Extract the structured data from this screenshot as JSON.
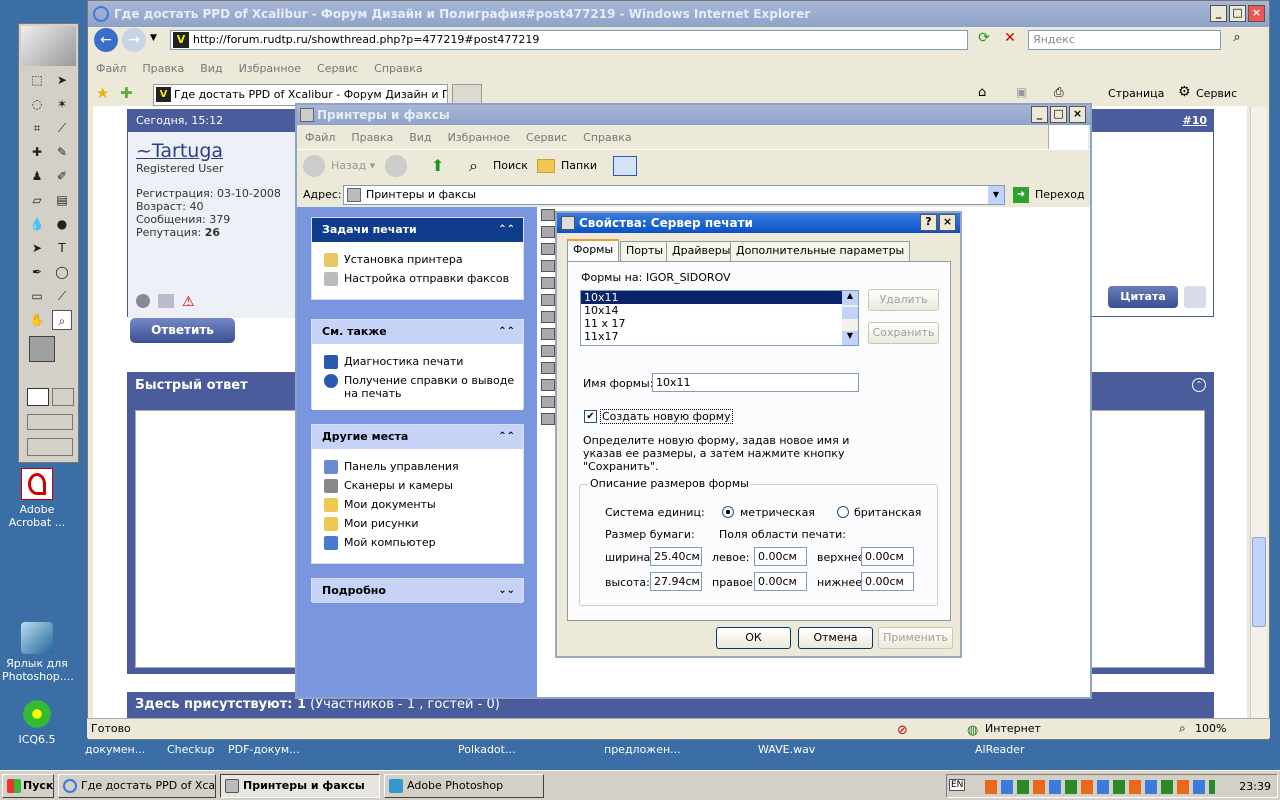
{
  "desktop": {
    "icons": [
      {
        "label": "Adobe Acrobat ...",
        "icon": "pdf-icon"
      },
      {
        "label": "Ярлык для Photoshop....",
        "icon": "feather-icon"
      },
      {
        "label": "ICQ6.5",
        "icon": "flower-icon"
      }
    ],
    "bottom_labels": [
      "докумен...",
      "Checkup",
      "PDF-докум...",
      "Polkadot...",
      "предложен...",
      "WAVE.wav",
      "AlReader"
    ]
  },
  "ie": {
    "title": "Где достать PPD of Xcalibur - Форум Дизайн и Полиграфия#post477219 - Windows Internet Explorer",
    "address": "http://forum.rudtp.ru/showthread.php?p=477219#post477219",
    "search_placeholder": "Яндекс",
    "menu": [
      "Файл",
      "Правка",
      "Вид",
      "Избранное",
      "Сервис",
      "Справка"
    ],
    "tab_title": "Где достать PPD of Xcalibur - Форум Дизайн и Поли...",
    "toolbar_right": [
      "Страница",
      "Сервис"
    ],
    "status": {
      "left": "Готово",
      "zone": "Интернет",
      "zoom": "100%"
    }
  },
  "forum": {
    "post_date": "Сегодня, 15:12",
    "post_number_prefix": "#",
    "post_number": "10",
    "username": "~Tartuga",
    "user_title": "Registered User",
    "reg_label": "Регистрация:",
    "reg_date": "03-10-2008",
    "age_label": "Возраст:",
    "age": "40",
    "posts_label": "Сообщения:",
    "posts": "379",
    "rep_label": "Репутация:",
    "rep": "26",
    "reply_button": "Ответить",
    "quote_button": "Цитата",
    "quick_reply": "Быстрый ответ",
    "present_bold": "Здесь присутствуют: 1",
    "present_rest": "(Участников - 1 , гостей - 0)"
  },
  "printers": {
    "title": "Принтеры и факсы",
    "menu": [
      "Файл",
      "Правка",
      "Вид",
      "Избранное",
      "Сервис",
      "Справка"
    ],
    "toolbar": {
      "back": "Назад",
      "search": "Поиск",
      "folders": "Папки"
    },
    "address_label": "Адрес:",
    "address": "Принтеры и факсы",
    "go": "Переход",
    "tasks_head": "Задачи печати",
    "tasks": [
      "Установка принтера",
      "Настройка отправки факсов"
    ],
    "see_also_head": "См. также",
    "see_also": [
      "Диагностика печати",
      "Получение справки о выводе на печать"
    ],
    "other_head": "Другие места",
    "other": [
      "Панель управления",
      "Сканеры и камеры",
      "Мои документы",
      "Мои рисунки",
      "Мой компьютер"
    ],
    "details_head": "Подробно"
  },
  "dialog": {
    "title": "Свойства: Сервер печати",
    "tabs": [
      "Формы",
      "Порты",
      "Драйверы",
      "Дополнительные параметры"
    ],
    "forms_on_label": "Формы на:",
    "server_name": "IGOR_SIDOROV",
    "forms_list": [
      "10x11",
      "10x14",
      "11 x 17",
      "11x17"
    ],
    "delete_btn": "Удалить",
    "save_btn": "Сохранить",
    "form_name_label": "Имя формы:",
    "form_name": "10x11",
    "create_new_label": "Создать новую форму",
    "create_new_checked": true,
    "hint": "Определите новую форму, задав новое имя и указав ее размеры, а затем нажмите кнопку \"Сохранить\".",
    "group_label": "Описание размеров формы",
    "units_label": "Система единиц:",
    "metric_label": "метрическая",
    "imperial_label": "британская",
    "paper_size_label": "Размер бумаги:",
    "margins_label": "Поля области печати:",
    "width_label": "ширина:",
    "width": "25.40см",
    "height_label": "высота:",
    "height": "27.94см",
    "left_label": "левое:",
    "left": "0.00см",
    "right_label": "правое:",
    "right": "0.00см",
    "top_label": "верхнее:",
    "top": "0.00см",
    "bottom_label": "нижнее:",
    "bottom": "0.00см",
    "ok": "ОК",
    "cancel": "Отмена",
    "apply": "Применить"
  },
  "taskbar": {
    "start": "Пуск",
    "buttons": [
      "Где достать PPD of Xca...",
      "Принтеры и факсы",
      "Adobe Photoshop"
    ],
    "lang": "EN",
    "time": "23:39"
  },
  "colors": {
    "xp_blue": "#0b52c7",
    "forum_blue": "#4a5c9c",
    "task_blue": "#0f3d8c"
  }
}
